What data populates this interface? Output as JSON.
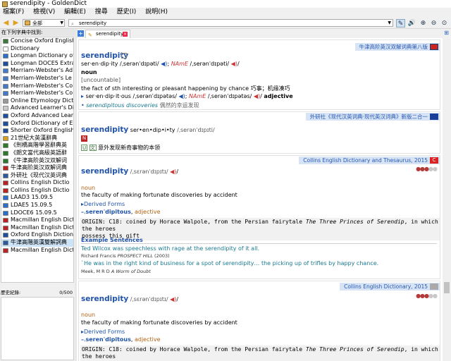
{
  "window": {
    "title": "serendipity - GoldenDict"
  },
  "menu": [
    "檔案(F)",
    "檢視(V)",
    "編輯(E)",
    "搜尋",
    "歷史(I)",
    "說明(H)"
  ],
  "toolbar": {
    "group": "全部",
    "search_value": "serendipity"
  },
  "left_pane": {
    "dict_header": "在下列字典中找到:",
    "dictionaries": [
      {
        "label": "Concise Oxford English",
        "color": "#3a7a3a"
      },
      {
        "label": "Dictionary",
        "color": "#ffffff"
      },
      {
        "label": "Longman Dictionary of",
        "color": "#2a6fc9"
      },
      {
        "label": "Longman DOCE5 Extra",
        "color": "#1d4fa0"
      },
      {
        "label": "Merriam-Webster's Ad",
        "color": "#4478c8"
      },
      {
        "label": "Merriam-Webster's Le",
        "color": "#4478c8"
      },
      {
        "label": "Merriam-Webster's Co",
        "color": "#4478c8"
      },
      {
        "label": "Merriam-Webster's Co",
        "color": "#4478c8"
      },
      {
        "label": "Online Etymology Dict",
        "color": "#999999"
      },
      {
        "label": "Advanced Learner's Dic",
        "color": "#cccccc"
      },
      {
        "label": "Oxford Advanced Learn",
        "color": "#1d4fa0"
      },
      {
        "label": "Oxford Dictionary of Er",
        "color": "#1d4fa0"
      },
      {
        "label": "Shorter Oxford English",
        "color": "#1d4fa0"
      },
      {
        "label": "21世紀大英漢辭典",
        "color": "#d9a020"
      },
      {
        "label": "《劍橋高階學習辭典英",
        "color": "#2a7a2a"
      },
      {
        "label": "《朗文當代高級英語辭",
        "color": "#2a7a2a"
      },
      {
        "label": "《牛津高阶英汉双解词",
        "color": "#2a7a2a"
      },
      {
        "label": "牛津高阶英汉双解词典",
        "color": "#c02020"
      },
      {
        "label": "外研社《现代汉英词典",
        "color": "#2a5aa0"
      },
      {
        "label": "Collins English Dictio",
        "color": "#c02020"
      },
      {
        "label": "Collins English Dictio",
        "color": "#c02020"
      },
      {
        "label": "LAAD3 15.09.5",
        "color": "#2a6fc9"
      },
      {
        "label": "LDAE5 15.09.5",
        "color": "#2a6fc9"
      },
      {
        "label": "LDOCE6 15.09.5",
        "color": "#2a6fc9"
      },
      {
        "label": "Macmillan English Dict",
        "color": "#c02020"
      },
      {
        "label": "Macmillan English Dict",
        "color": "#c02020"
      },
      {
        "label": "Oxford English Diction",
        "color": "#1d4fa0"
      },
      {
        "label": "牛津高階英漢雙解詞典",
        "color": "#2a5aa0"
      },
      {
        "label": "Macmillan English Dict",
        "color": "#c02020"
      }
    ],
    "history_header": "歷史紀錄:",
    "history_count": "0/500"
  },
  "tab": {
    "label": "serendipity"
  },
  "entries": {
    "oald": {
      "header": "牛津高阶英汉双解词典第八版",
      "headword": "serendipity",
      "syllab": "ser·en·dip·ity",
      "pron_br": "/ˌserənˈdɪpəti/",
      "name_label": "NAmE",
      "pron_am": "/ˌserənˈdɪpəti/",
      "pos": "noun",
      "grammar": "[uncountable]",
      "def_en": "the fact of sth interesting or pleasant happening by chance",
      "def_zh": "巧事；机缘凑巧",
      "deriv_syllab": "ser·en·dip·it·ous",
      "deriv_pron_br": "/ˌserənˈdɪpətəs/",
      "deriv_pron_am": "/ˌserənˈdɪpətəs/",
      "deriv_pos": "adjective",
      "example_en": "serendipitous discoveries",
      "example_zh": "偶然的幸运发现"
    },
    "fltrp": {
      "header": "外研社《现代汉英词典·现代英汉词典》新版二合一",
      "headword": "serendipity",
      "syllab": "ser•en•dip•i•ty",
      "pron": "/ˌserənˈdɪpɪti/",
      "badge_n": "N",
      "badge_u": "U",
      "badge_wen": "文",
      "def_zh": "意外发现新奇事物的本领"
    },
    "collins1": {
      "header": "Collins English Dictionary and Thesaurus, 2015",
      "headword": "serendipity",
      "pron": "/ˌsɛrənˈdɪpɪtɪ/",
      "pos": "noun",
      "def": "the faculty of making fortunate discoveries by accident",
      "derived_label": "▸Derived Forms",
      "derived_word": "–ˌserenˈdipitous",
      "derived_pos": "adjective",
      "origin": "ORIGIN: C18: coined by Horace Walpole, from the Persian fairytale",
      "origin_title": "The Three Princes of Serendip",
      "origin_tail": ", in which the heroes",
      "origin_line2": "possess this gift",
      "examples_label": "Example Sentences",
      "ex1": "Ted Wilcox was speechless with rage at the serendipity of it all.",
      "ex1_src_author": "Richard Francis",
      "ex1_src_title": "PROSPECT HILL",
      "ex1_src_year": "(2003)",
      "ex2": "`He was in the right kind of business for a spot of serendipity… the picking up of trifles by happy chance.",
      "ex2_src_author": "Meek, M R D",
      "ex2_src_title": "A Worm of Doubt"
    },
    "collins2": {
      "header": "Collins English Dictionary, 2015",
      "headword": "serendipity",
      "pron": "/ˌsɛrənˈdɪpɪtɪ/",
      "pos": "noun",
      "def": "the faculty of making fortunate discoveries by accident",
      "derived_label": "▸Derived Forms",
      "derived_word": "–ˌserenˈdipitous",
      "derived_pos": "adjective",
      "origin": "ORIGIN: C18: coined by Horace Walpole, from the Persian fairytale",
      "origin_title": "The Three Princes of Serendip",
      "origin_tail": ", in which the heroes"
    }
  },
  "colors": {
    "accent": "#1f52a8",
    "header_bg": "#d7e4f5",
    "speaker": "#c33333"
  }
}
